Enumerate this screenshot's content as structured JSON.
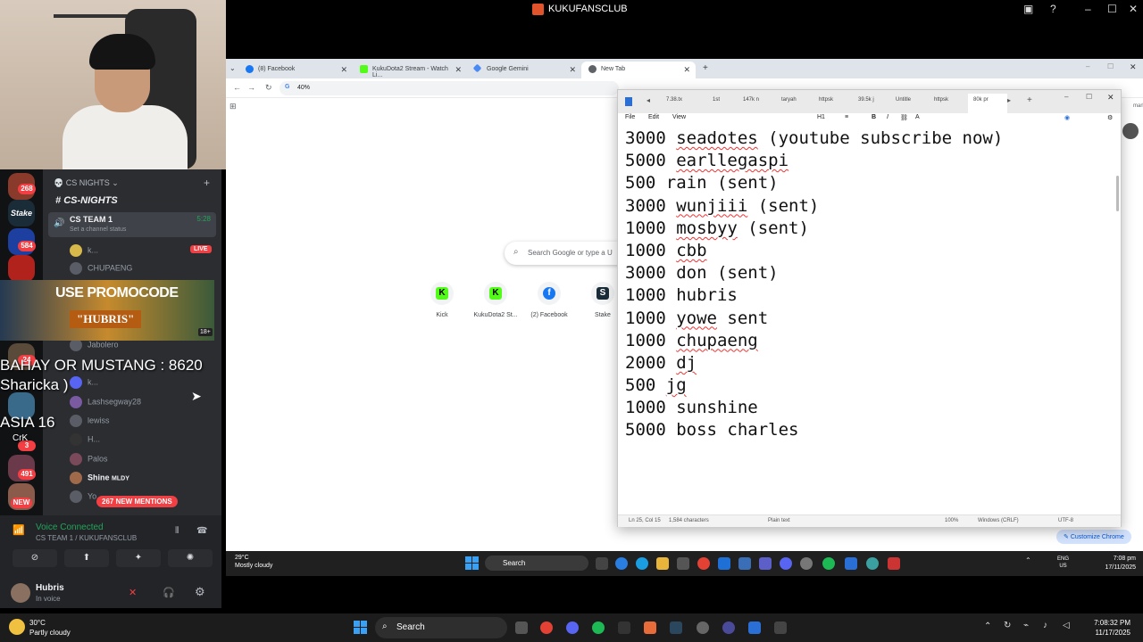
{
  "window_title": "KUKUFANSCLUB",
  "overlay": {
    "bahay": "BAHAY OR MUSTANG : 8620",
    "sharicka": "Sharicka )",
    "asia": "ASIA 16",
    "crk": "CrK"
  },
  "promo": {
    "line1": "USE PROMOCODE",
    "line2": "\"HUBRIS\"",
    "age": "18+"
  },
  "rail": {
    "badges": [
      "268",
      "584",
      "24",
      "3",
      "491"
    ],
    "labels": [
      "Stake",
      "NEW"
    ]
  },
  "discord": {
    "server_name": "CS NIGHTS",
    "channel": "CS-NIGHTS",
    "voice_channel": "CS TEAM 1",
    "voice_status": "Set a channel status",
    "voice_time": "5:28",
    "live": "LIVE",
    "members": [
      "k...",
      "CHUPAENG",
      "Jabolero",
      "k...",
      "Lashsegway28",
      "lewiss",
      "H...",
      "Palos",
      "Shine",
      "Yo..."
    ],
    "shine_tag": "MLDY",
    "mentions": "267 NEW MENTIONS",
    "voice_connected": "Voice Connected",
    "voice_connected_sub": "CS TEAM 1 / KUKUFANSCLUB",
    "user_name": "Hubris",
    "user_state": "In voice"
  },
  "browser": {
    "tabs": [
      {
        "label": "(8) Facebook"
      },
      {
        "label": "KukuDota2 Stream - Watch Li..."
      },
      {
        "label": "Google Gemini"
      },
      {
        "label": "New Tab"
      }
    ],
    "address": "40%",
    "search_placeholder": "Search Google or type a U",
    "shortcuts": [
      {
        "label": "Kick",
        "glyph": "K"
      },
      {
        "label": "KukuDota2 St...",
        "glyph": "K"
      },
      {
        "label": "(2) Facebook",
        "glyph": "f"
      },
      {
        "label": "Stake",
        "glyph": "S"
      }
    ],
    "customize": "Customize Chrome",
    "right_text": "marks"
  },
  "notepad": {
    "tabs": [
      "7.38.tx",
      "1st",
      "147k n",
      "taryah",
      "httpsk",
      "39.5k j",
      "Untitle",
      "httpsk",
      "80k pr"
    ],
    "menu": [
      "File",
      "Edit",
      "View"
    ],
    "heading": "H1",
    "lines": [
      {
        "amt": "3000",
        "name": "seadotes",
        "rest": " (youtube subscribe now)",
        "squig": true
      },
      {
        "amt": "5000",
        "name": "earllegaspi",
        "rest": "",
        "squig": true
      },
      {
        "amt": "500",
        "name": "rain",
        "rest": " (sent)",
        "squig": false
      },
      {
        "amt": "3000",
        "name": "wunjiii",
        "rest": " (sent)",
        "squig": true
      },
      {
        "amt": "1000",
        "name": "mosbyy",
        "rest": " (sent)",
        "squig": true
      },
      {
        "amt": "1000",
        "name": "cbb",
        "rest": "",
        "squig": true
      },
      {
        "amt": "3000",
        "name": "don",
        "rest": " (sent)",
        "squig": false
      },
      {
        "amt": "1000",
        "name": "hubris",
        "rest": "",
        "squig": false
      },
      {
        "amt": "1000",
        "name": "yowe",
        "rest": " sent",
        "squig": true
      },
      {
        "amt": "1000",
        "name": "chupaeng",
        "rest": "",
        "squig": true
      },
      {
        "amt": "2000",
        "name": "dj",
        "rest": "",
        "squig": true
      },
      {
        "amt": "500",
        "name": "jg",
        "rest": "",
        "squig": true
      },
      {
        "amt": "1000",
        "name": "sunshine",
        "rest": "",
        "squig": false
      },
      {
        "amt": "5000",
        "name": "boss",
        "rest": " charles",
        "squig": false
      }
    ],
    "status": {
      "pos": "Ln 25, Col 15",
      "chars": "1,584 characters",
      "format": "Plain text",
      "zoom": "100%",
      "eol": "Windows (CRLF)",
      "enc": "UTF-8"
    }
  },
  "taskbar_inner": {
    "temp": "29°C",
    "weather": "Mostly cloudy",
    "search": "Search",
    "lang1": "ENG",
    "lang2": "US",
    "time": "7:08 pm",
    "date": "17/11/2025"
  },
  "taskbar_outer": {
    "temp": "30°C",
    "weather": "Partly cloudy",
    "search": "Search",
    "time": "7:08:32 PM",
    "date": "11/17/2025"
  }
}
